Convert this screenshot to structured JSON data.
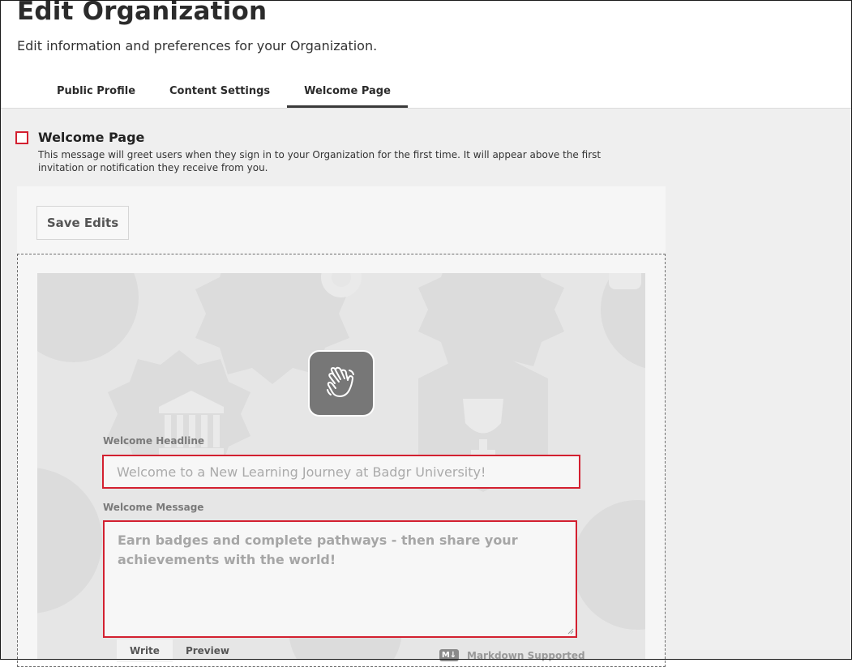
{
  "header": {
    "title": "Edit Organization",
    "subtitle": "Edit information and preferences for your Organization."
  },
  "tabs": [
    {
      "label": "Public Profile"
    },
    {
      "label": "Content Settings"
    },
    {
      "label": "Welcome Page"
    }
  ],
  "active_tab": "Welcome Page",
  "section": {
    "title": "Welcome Page",
    "description": "This message will greet users when they sign in to your Organization for the first time. It will appear above the first invitation or notification they receive from you."
  },
  "toolbar": {
    "save_label": "Save Edits"
  },
  "form": {
    "headline_label": "Welcome Headline",
    "headline_placeholder": "Welcome to a New Learning Journey at Badgr University!",
    "message_label": "Welcome Message",
    "message_placeholder": "Earn badges and complete pathways - then share your achievements with the world!"
  },
  "editor": {
    "write_tab": "Write",
    "preview_tab": "Preview",
    "markdown_badge": "M↓",
    "markdown_note": "Markdown Supported"
  },
  "icons": {
    "welcome": "waving-hand-icon"
  },
  "colors": {
    "highlight": "#d32030",
    "tab_underline": "#3a3a3a",
    "tile": "#777777"
  }
}
